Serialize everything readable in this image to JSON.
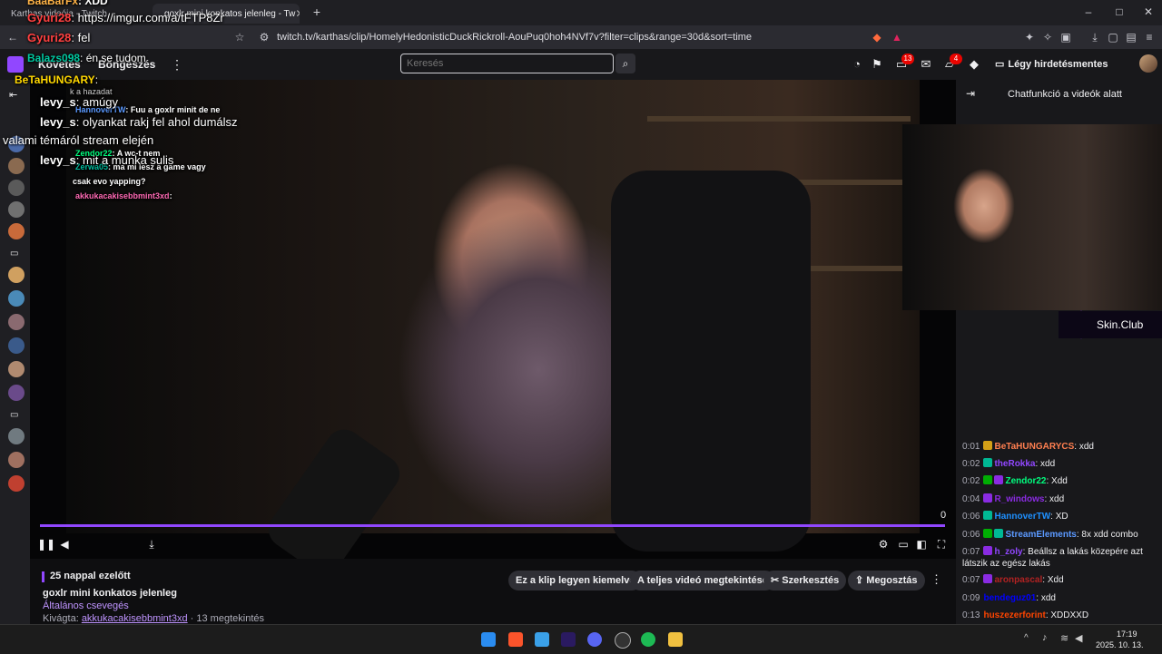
{
  "browser": {
    "tabs": [
      {
        "title": "Karthas videója - Twitch",
        "active": false
      },
      {
        "title": "goxlr mini konkatos jelenleg - Tw",
        "active": true
      }
    ],
    "new_tab": "+",
    "url": "twitch.tv/karthas/clip/HomelyHedonisticDuckRickroll-AouPuq0hoh4NVf7v?filter=clips&range=30d&sort=time",
    "window_controls": [
      "–",
      "□",
      "✕"
    ]
  },
  "nav": {
    "follow": "Követés",
    "browse": "Böngészés",
    "more": "⋮",
    "search_placeholder": "Keresés",
    "inbox_badge": "13",
    "whispers_badge": "4",
    "ad_free": "Légy hirdetésmentes ingyen"
  },
  "overlay_chat": [
    {
      "user": "BaaBarFx",
      "text": "XDD"
    },
    {
      "user": "Gyuri28",
      "text": "https://imgur.com/a/tFTP8Zr"
    },
    {
      "user": "Gyuri28",
      "text": "fel"
    },
    {
      "user": "Balazs098",
      "text": "én se tudom"
    },
    {
      "user": "BeTaHUNGARY",
      "text": ""
    },
    {
      "user": "levy_s",
      "text": "amúgy"
    },
    {
      "user": "levy_s",
      "text": "olyankat rakj fel ahol dumálsz"
    },
    {
      "user": "",
      "text": "valami témáról stream elején"
    },
    {
      "user": "levy_s",
      "text": "mit a munka sulis"
    }
  ],
  "video_chat": [
    {
      "user": "",
      "text": "k a hazadat"
    },
    {
      "user": "HannoverTW",
      "text": "Fuu a goxlr minit de ne"
    },
    {
      "user": "Zendor22",
      "text": "A wc-t nem"
    },
    {
      "user": "Zerwa05",
      "text": "ma mi lesz a game vagy"
    },
    {
      "user": "",
      "text": "csak evo yapping?"
    },
    {
      "user": "akkukacakisebbmint3xd",
      "text": ""
    }
  ],
  "video": {
    "progress": 1.0,
    "time": "0"
  },
  "clip": {
    "ago": "25 nappal ezelőtt",
    "title": "goxlr mini konkatos jelenleg",
    "category": "Általános csevegés",
    "clipped_by_label": "Kivágta:",
    "clipped_by": "akkukacakisebbmint3xd",
    "views": "· 13 megtekintés",
    "actions": {
      "feature": "Ez a klip legyen kiemelve",
      "full_video": "A teljes videó megtekintése",
      "edit": "Szerkesztés",
      "share": "Megosztás"
    }
  },
  "chat_panel": {
    "header": "Chatfunkció a videók alatt",
    "sponsor": "Skin.Club",
    "messages": [
      {
        "ts": "0:01",
        "user": "BeTaHUNGARYCS",
        "color": "#ff7f50",
        "text": ": xdd"
      },
      {
        "ts": "0:02",
        "user": "theRokka",
        "color": "#9147ff",
        "text": ": xdd"
      },
      {
        "ts": "0:02",
        "user": "Zendor22",
        "color": "#00ff7f",
        "text": ": Xdd"
      },
      {
        "ts": "0:04",
        "user": "R_windows",
        "color": "#8a2be2",
        "text": ": xdd"
      },
      {
        "ts": "0:06",
        "user": "HannoverTW",
        "color": "#1e90ff",
        "text": ": XD"
      },
      {
        "ts": "0:06",
        "user": "StreamElements",
        "color": "#5b99ff",
        "text": ": 8x xdd combo"
      },
      {
        "ts": "0:07",
        "user": "h_zoly",
        "color": "#9147ff",
        "text": ": Beállsz a lakás közepére azt látszik az egész lakás"
      },
      {
        "ts": "0:07",
        "user": "aronpascal",
        "color": "#b22222",
        "text": ": Xdd"
      },
      {
        "ts": "0:09",
        "user": "bendeguz01",
        "color": "#0000ff",
        "text": ": xdd"
      },
      {
        "ts": "0:13",
        "user": "huszezerforint",
        "color": "#ff4500",
        "text": ": XDDXXD"
      }
    ]
  },
  "taskbar": {
    "time": "17:19",
    "date": "2025. 10. 13."
  }
}
